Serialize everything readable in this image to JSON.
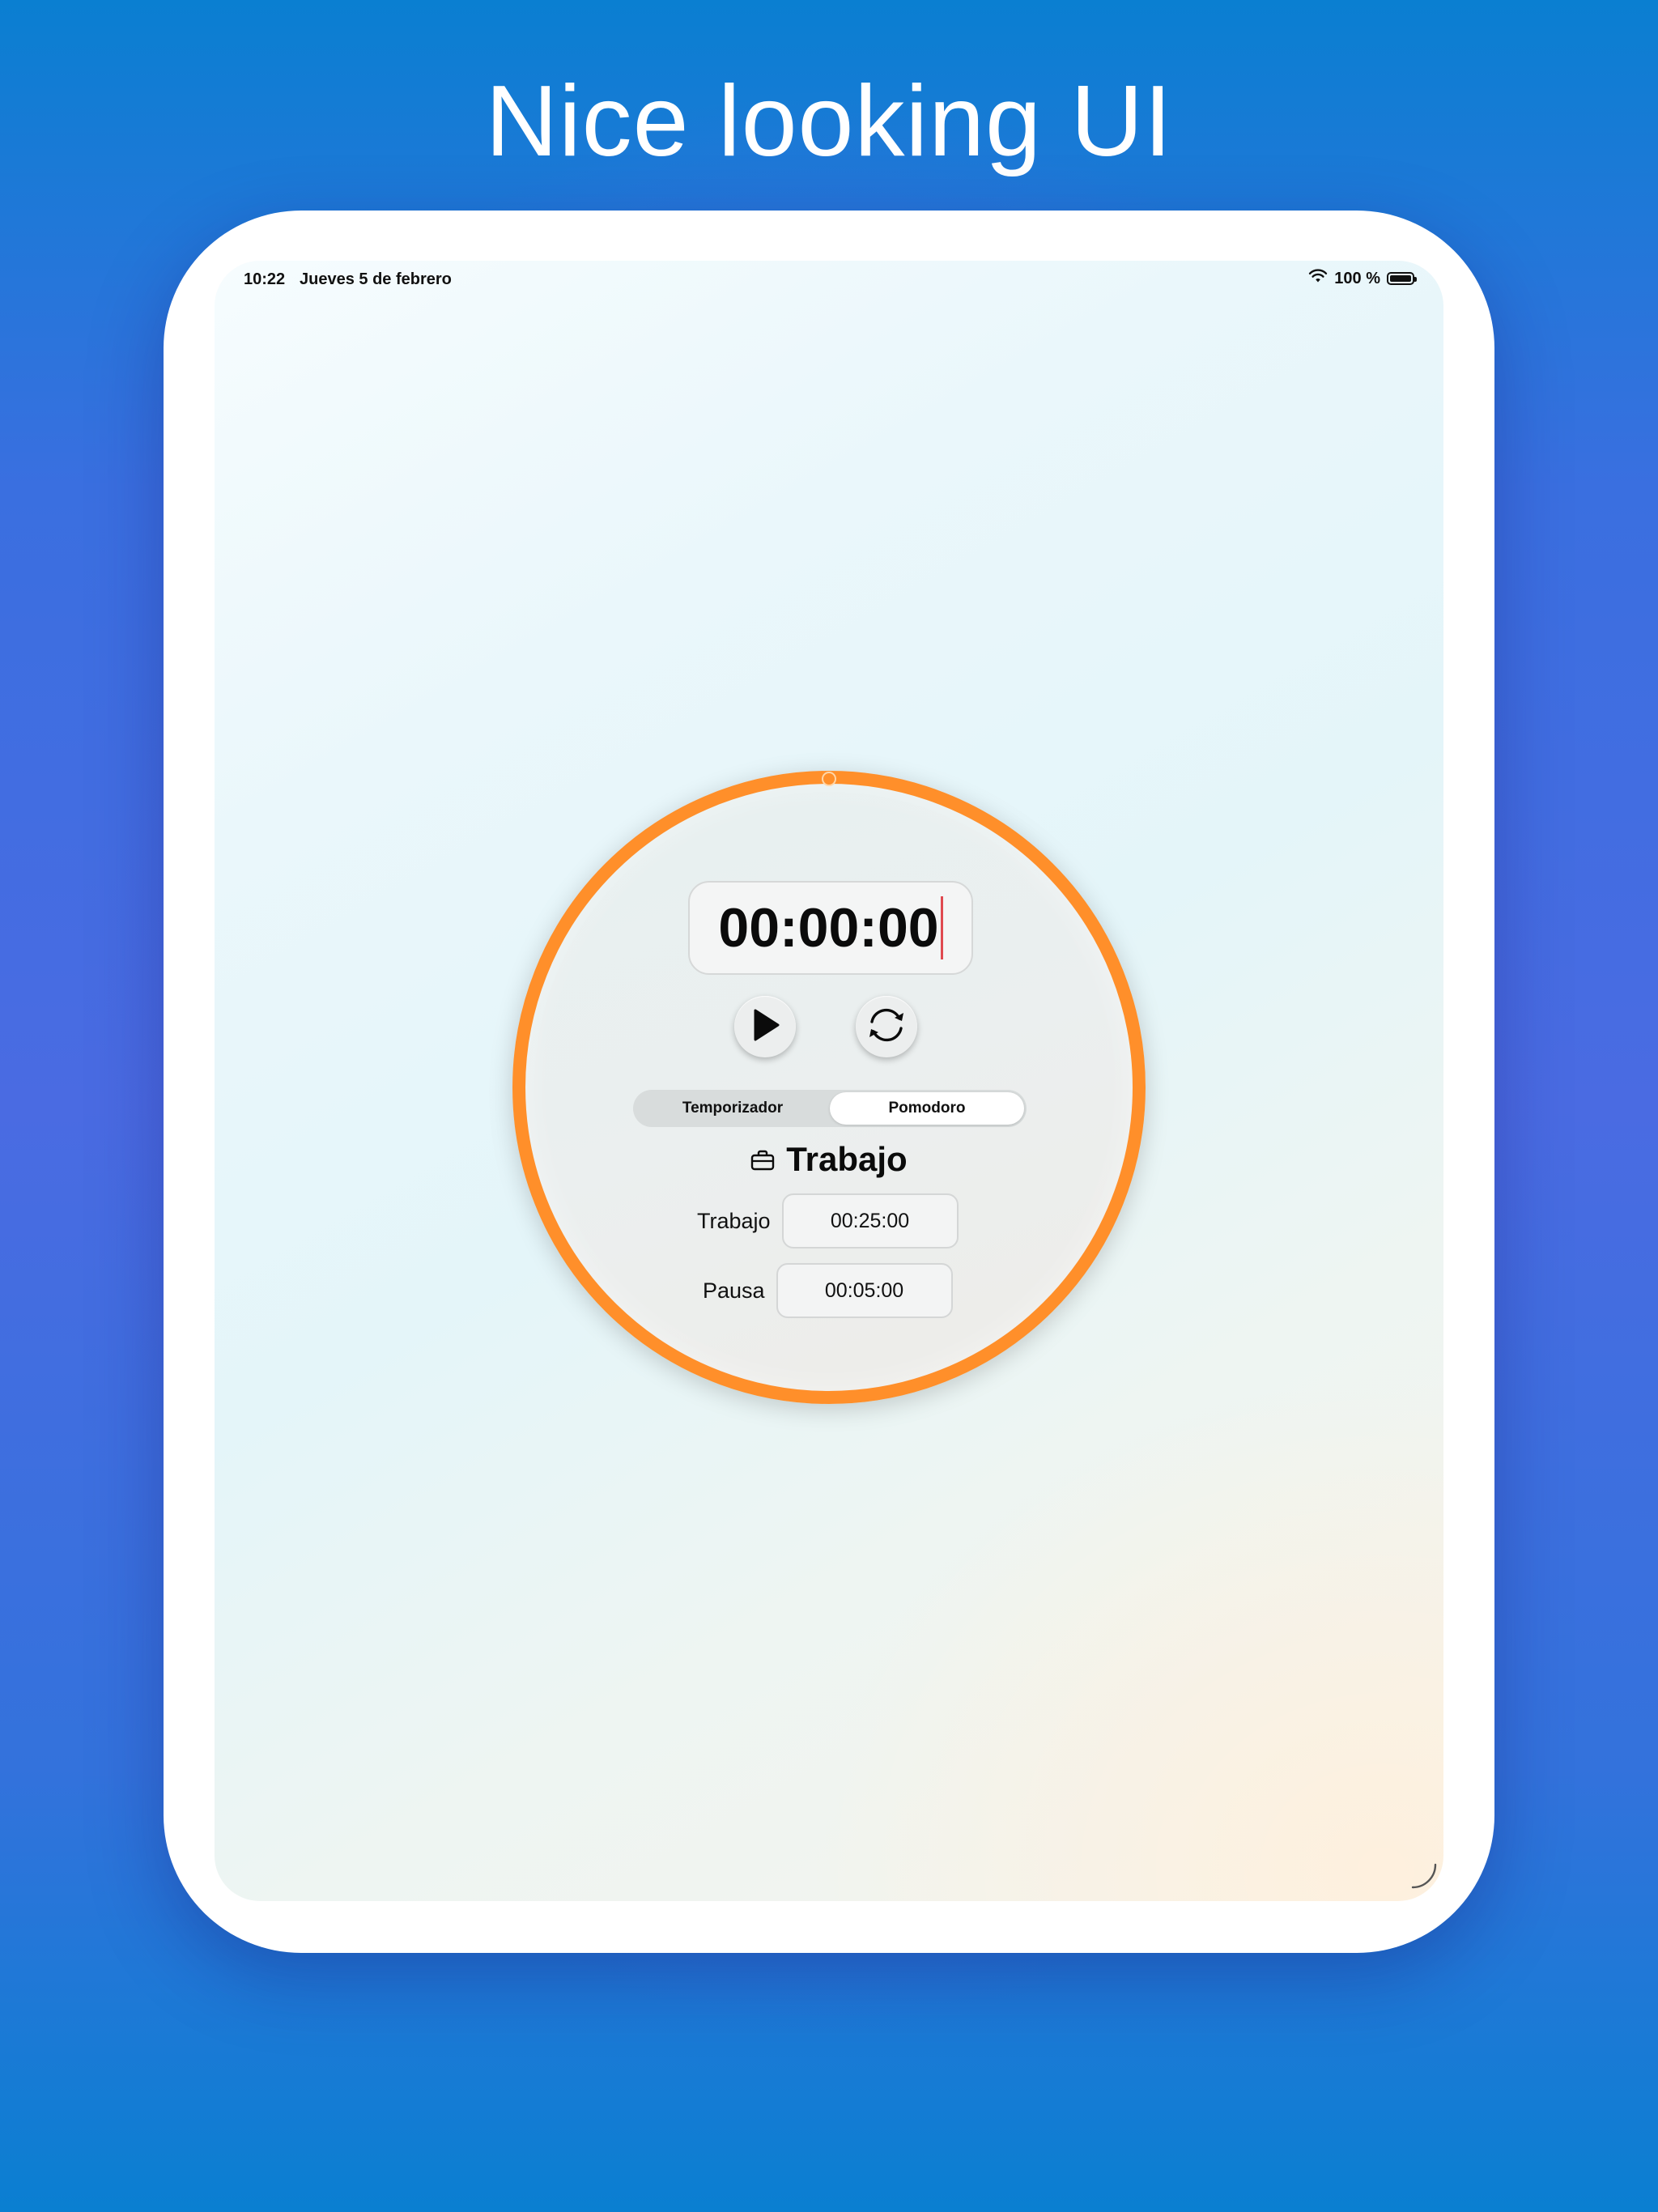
{
  "headline": "Nice looking UI",
  "status_bar": {
    "time": "10:22",
    "date": "Jueves 5 de febrero",
    "battery": "100 %"
  },
  "timer": {
    "display": "00:00:00",
    "accent_color": "#ff8f2a",
    "progress": 0
  },
  "controls": {
    "play_icon": "play-icon",
    "reset_icon": "reset-icon"
  },
  "segments": {
    "items": [
      "Temporizador",
      "Pomodoro"
    ],
    "selected": "Pomodoro"
  },
  "mode": {
    "icon": "briefcase-icon",
    "title": "Trabajo"
  },
  "fields": {
    "work_label": "Trabajo",
    "work_value": "00:25:00",
    "pause_label": "Pausa",
    "pause_value": "00:05:00"
  }
}
